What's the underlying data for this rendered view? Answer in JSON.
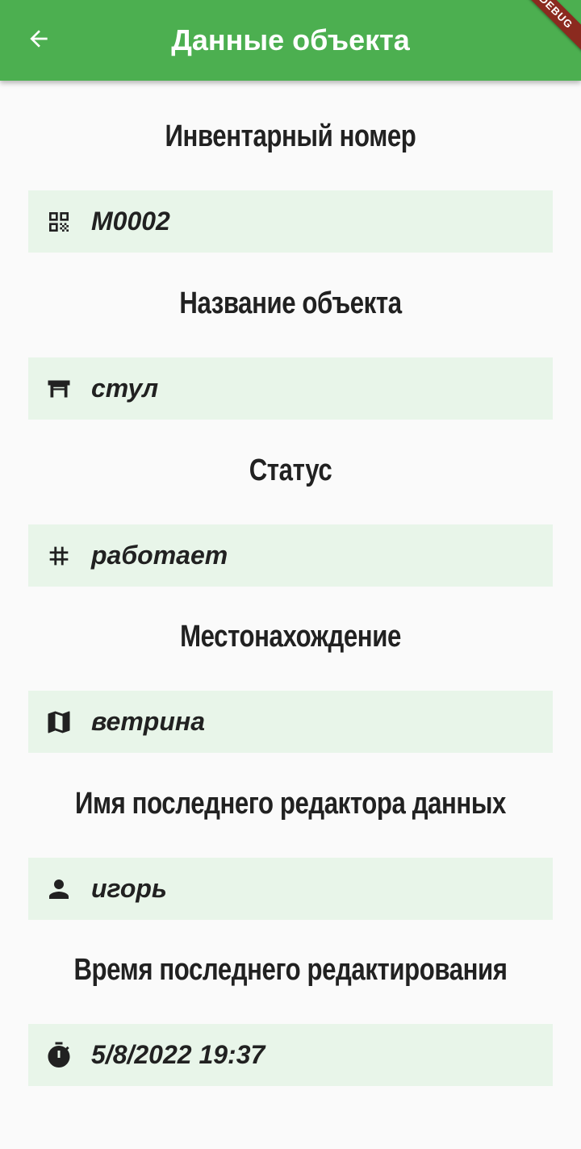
{
  "appbar": {
    "title": "Данные объекта",
    "back_icon": "arrow-back-icon",
    "banner": "DEBUG",
    "color": "#4caf50"
  },
  "fields": [
    {
      "label": "Инвентарный номер",
      "value": "M0002",
      "icon": "qr-code-icon"
    },
    {
      "label": "Название объекта",
      "value": "стул",
      "icon": "table-icon"
    },
    {
      "label": "Статус",
      "value": "работает",
      "icon": "tag-icon"
    },
    {
      "label": "Местонахождение",
      "value": "ветрина",
      "icon": "map-icon"
    },
    {
      "label": "Имя последнего редактора данных",
      "value": "игорь",
      "icon": "person-icon"
    },
    {
      "label": "Время последнего редактирования",
      "value": "5/8/2022 19:37",
      "icon": "timer-icon"
    }
  ],
  "colors": {
    "field_background": "#e8f5e9",
    "page_background": "#fafafa"
  }
}
